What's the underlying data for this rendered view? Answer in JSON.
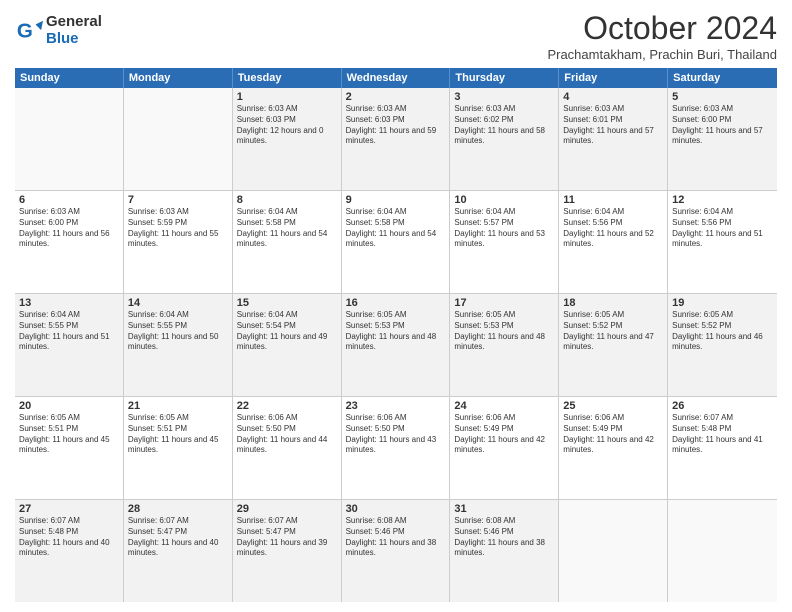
{
  "header": {
    "logo": {
      "general": "General",
      "blue": "Blue"
    },
    "title": "October 2024",
    "subtitle": "Prachamtakham, Prachin Buri, Thailand"
  },
  "calendar": {
    "days": [
      "Sunday",
      "Monday",
      "Tuesday",
      "Wednesday",
      "Thursday",
      "Friday",
      "Saturday"
    ],
    "weeks": [
      [
        {
          "day": "",
          "empty": true
        },
        {
          "day": "",
          "empty": true
        },
        {
          "day": "1",
          "sunrise": "6:03 AM",
          "sunset": "6:03 PM",
          "daylight": "12 hours and 0 minutes."
        },
        {
          "day": "2",
          "sunrise": "6:03 AM",
          "sunset": "6:03 PM",
          "daylight": "11 hours and 59 minutes."
        },
        {
          "day": "3",
          "sunrise": "6:03 AM",
          "sunset": "6:02 PM",
          "daylight": "11 hours and 58 minutes."
        },
        {
          "day": "4",
          "sunrise": "6:03 AM",
          "sunset": "6:01 PM",
          "daylight": "11 hours and 57 minutes."
        },
        {
          "day": "5",
          "sunrise": "6:03 AM",
          "sunset": "6:00 PM",
          "daylight": "11 hours and 57 minutes."
        }
      ],
      [
        {
          "day": "6",
          "sunrise": "6:03 AM",
          "sunset": "6:00 PM",
          "daylight": "11 hours and 56 minutes."
        },
        {
          "day": "7",
          "sunrise": "6:03 AM",
          "sunset": "5:59 PM",
          "daylight": "11 hours and 55 minutes."
        },
        {
          "day": "8",
          "sunrise": "6:04 AM",
          "sunset": "5:58 PM",
          "daylight": "11 hours and 54 minutes."
        },
        {
          "day": "9",
          "sunrise": "6:04 AM",
          "sunset": "5:58 PM",
          "daylight": "11 hours and 54 minutes."
        },
        {
          "day": "10",
          "sunrise": "6:04 AM",
          "sunset": "5:57 PM",
          "daylight": "11 hours and 53 minutes."
        },
        {
          "day": "11",
          "sunrise": "6:04 AM",
          "sunset": "5:56 PM",
          "daylight": "11 hours and 52 minutes."
        },
        {
          "day": "12",
          "sunrise": "6:04 AM",
          "sunset": "5:56 PM",
          "daylight": "11 hours and 51 minutes."
        }
      ],
      [
        {
          "day": "13",
          "sunrise": "6:04 AM",
          "sunset": "5:55 PM",
          "daylight": "11 hours and 51 minutes."
        },
        {
          "day": "14",
          "sunrise": "6:04 AM",
          "sunset": "5:55 PM",
          "daylight": "11 hours and 50 minutes."
        },
        {
          "day": "15",
          "sunrise": "6:04 AM",
          "sunset": "5:54 PM",
          "daylight": "11 hours and 49 minutes."
        },
        {
          "day": "16",
          "sunrise": "6:05 AM",
          "sunset": "5:53 PM",
          "daylight": "11 hours and 48 minutes."
        },
        {
          "day": "17",
          "sunrise": "6:05 AM",
          "sunset": "5:53 PM",
          "daylight": "11 hours and 48 minutes."
        },
        {
          "day": "18",
          "sunrise": "6:05 AM",
          "sunset": "5:52 PM",
          "daylight": "11 hours and 47 minutes."
        },
        {
          "day": "19",
          "sunrise": "6:05 AM",
          "sunset": "5:52 PM",
          "daylight": "11 hours and 46 minutes."
        }
      ],
      [
        {
          "day": "20",
          "sunrise": "6:05 AM",
          "sunset": "5:51 PM",
          "daylight": "11 hours and 45 minutes."
        },
        {
          "day": "21",
          "sunrise": "6:05 AM",
          "sunset": "5:51 PM",
          "daylight": "11 hours and 45 minutes."
        },
        {
          "day": "22",
          "sunrise": "6:06 AM",
          "sunset": "5:50 PM",
          "daylight": "11 hours and 44 minutes."
        },
        {
          "day": "23",
          "sunrise": "6:06 AM",
          "sunset": "5:50 PM",
          "daylight": "11 hours and 43 minutes."
        },
        {
          "day": "24",
          "sunrise": "6:06 AM",
          "sunset": "5:49 PM",
          "daylight": "11 hours and 42 minutes."
        },
        {
          "day": "25",
          "sunrise": "6:06 AM",
          "sunset": "5:49 PM",
          "daylight": "11 hours and 42 minutes."
        },
        {
          "day": "26",
          "sunrise": "6:07 AM",
          "sunset": "5:48 PM",
          "daylight": "11 hours and 41 minutes."
        }
      ],
      [
        {
          "day": "27",
          "sunrise": "6:07 AM",
          "sunset": "5:48 PM",
          "daylight": "11 hours and 40 minutes."
        },
        {
          "day": "28",
          "sunrise": "6:07 AM",
          "sunset": "5:47 PM",
          "daylight": "11 hours and 40 minutes."
        },
        {
          "day": "29",
          "sunrise": "6:07 AM",
          "sunset": "5:47 PM",
          "daylight": "11 hours and 39 minutes."
        },
        {
          "day": "30",
          "sunrise": "6:08 AM",
          "sunset": "5:46 PM",
          "daylight": "11 hours and 38 minutes."
        },
        {
          "day": "31",
          "sunrise": "6:08 AM",
          "sunset": "5:46 PM",
          "daylight": "11 hours and 38 minutes."
        },
        {
          "day": "",
          "empty": true
        },
        {
          "day": "",
          "empty": true
        }
      ]
    ]
  }
}
